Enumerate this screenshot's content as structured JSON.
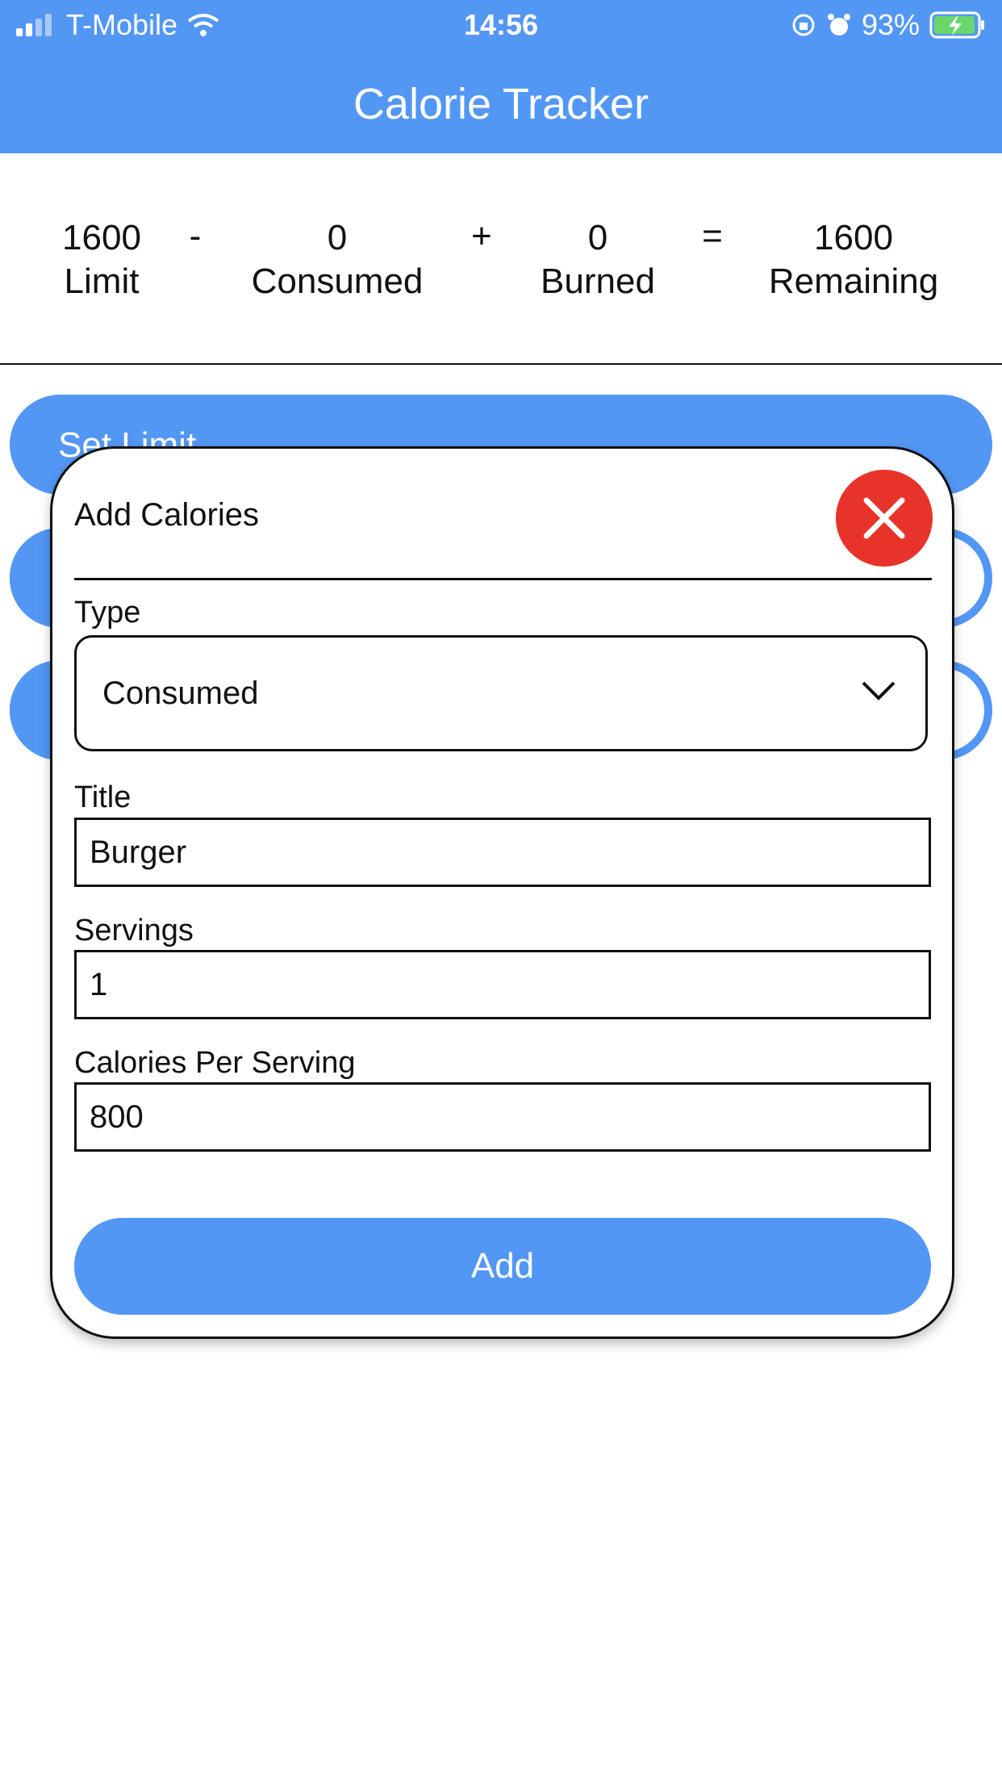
{
  "status_bar": {
    "carrier": "T-Mobile",
    "time": "14:56",
    "battery": "93%"
  },
  "header": {
    "title": "Calorie Tracker"
  },
  "summary": {
    "limit_value": "1600",
    "limit_label": "Limit",
    "minus": "-",
    "consumed_value": "0",
    "consumed_label": "Consumed",
    "plus": "+",
    "burned_value": "0",
    "burned_label": "Burned",
    "equals": "=",
    "remaining_value": "1600",
    "remaining_label": "Remaining"
  },
  "buttons": {
    "set_limit": "Set Limit"
  },
  "modal": {
    "title": "Add Calories",
    "type_label": "Type",
    "type_value": "Consumed",
    "title_label": "Title",
    "title_value": "Burger",
    "servings_label": "Servings",
    "servings_value": "1",
    "calories_label": "Calories Per Serving",
    "calories_value": "800",
    "add_label": "Add"
  },
  "colors": {
    "accent": "#5397f5",
    "close": "#e8332a"
  }
}
